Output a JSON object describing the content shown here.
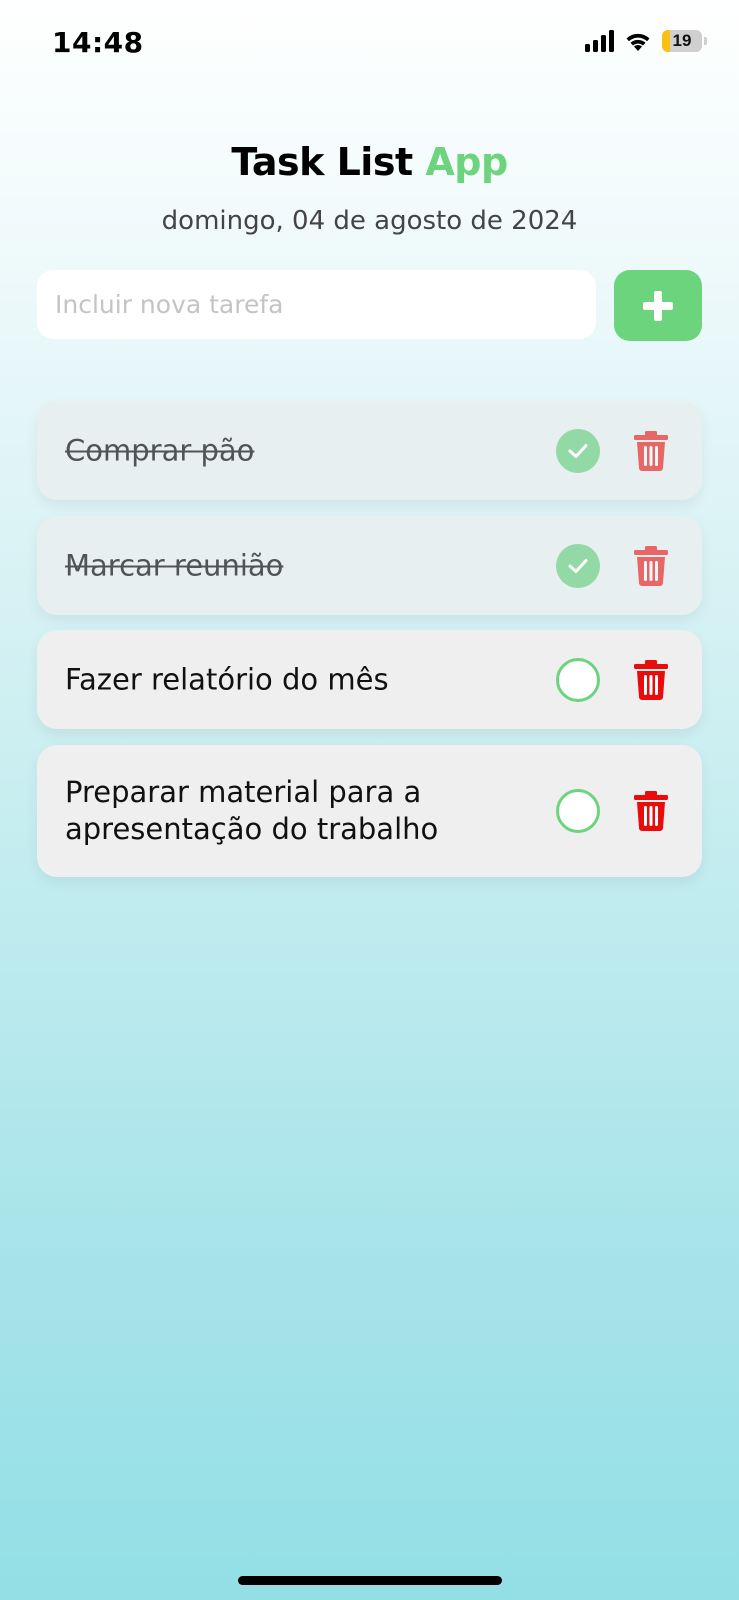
{
  "status_bar": {
    "time": "14:48",
    "battery": "19",
    "icons": [
      "signal-icon",
      "wifi-icon",
      "battery-icon"
    ]
  },
  "header": {
    "title_main": "Task List",
    "title_accent": "App",
    "date": "domingo, 04 de agosto de 2024"
  },
  "new_task": {
    "placeholder": "Incluir nova tarefa",
    "value": "",
    "add_icon": "plus-icon"
  },
  "tasks": [
    {
      "text": "Comprar pão",
      "done": true
    },
    {
      "text": "Marcar reunião",
      "done": true
    },
    {
      "text": "Fazer relatório do mês",
      "done": false
    },
    {
      "text": "Preparar material para a apresentação do trabalho",
      "done": false
    }
  ],
  "colors": {
    "accent": "#6dd47e",
    "delete": "#e80c0c",
    "checked": "#93d9a5"
  }
}
